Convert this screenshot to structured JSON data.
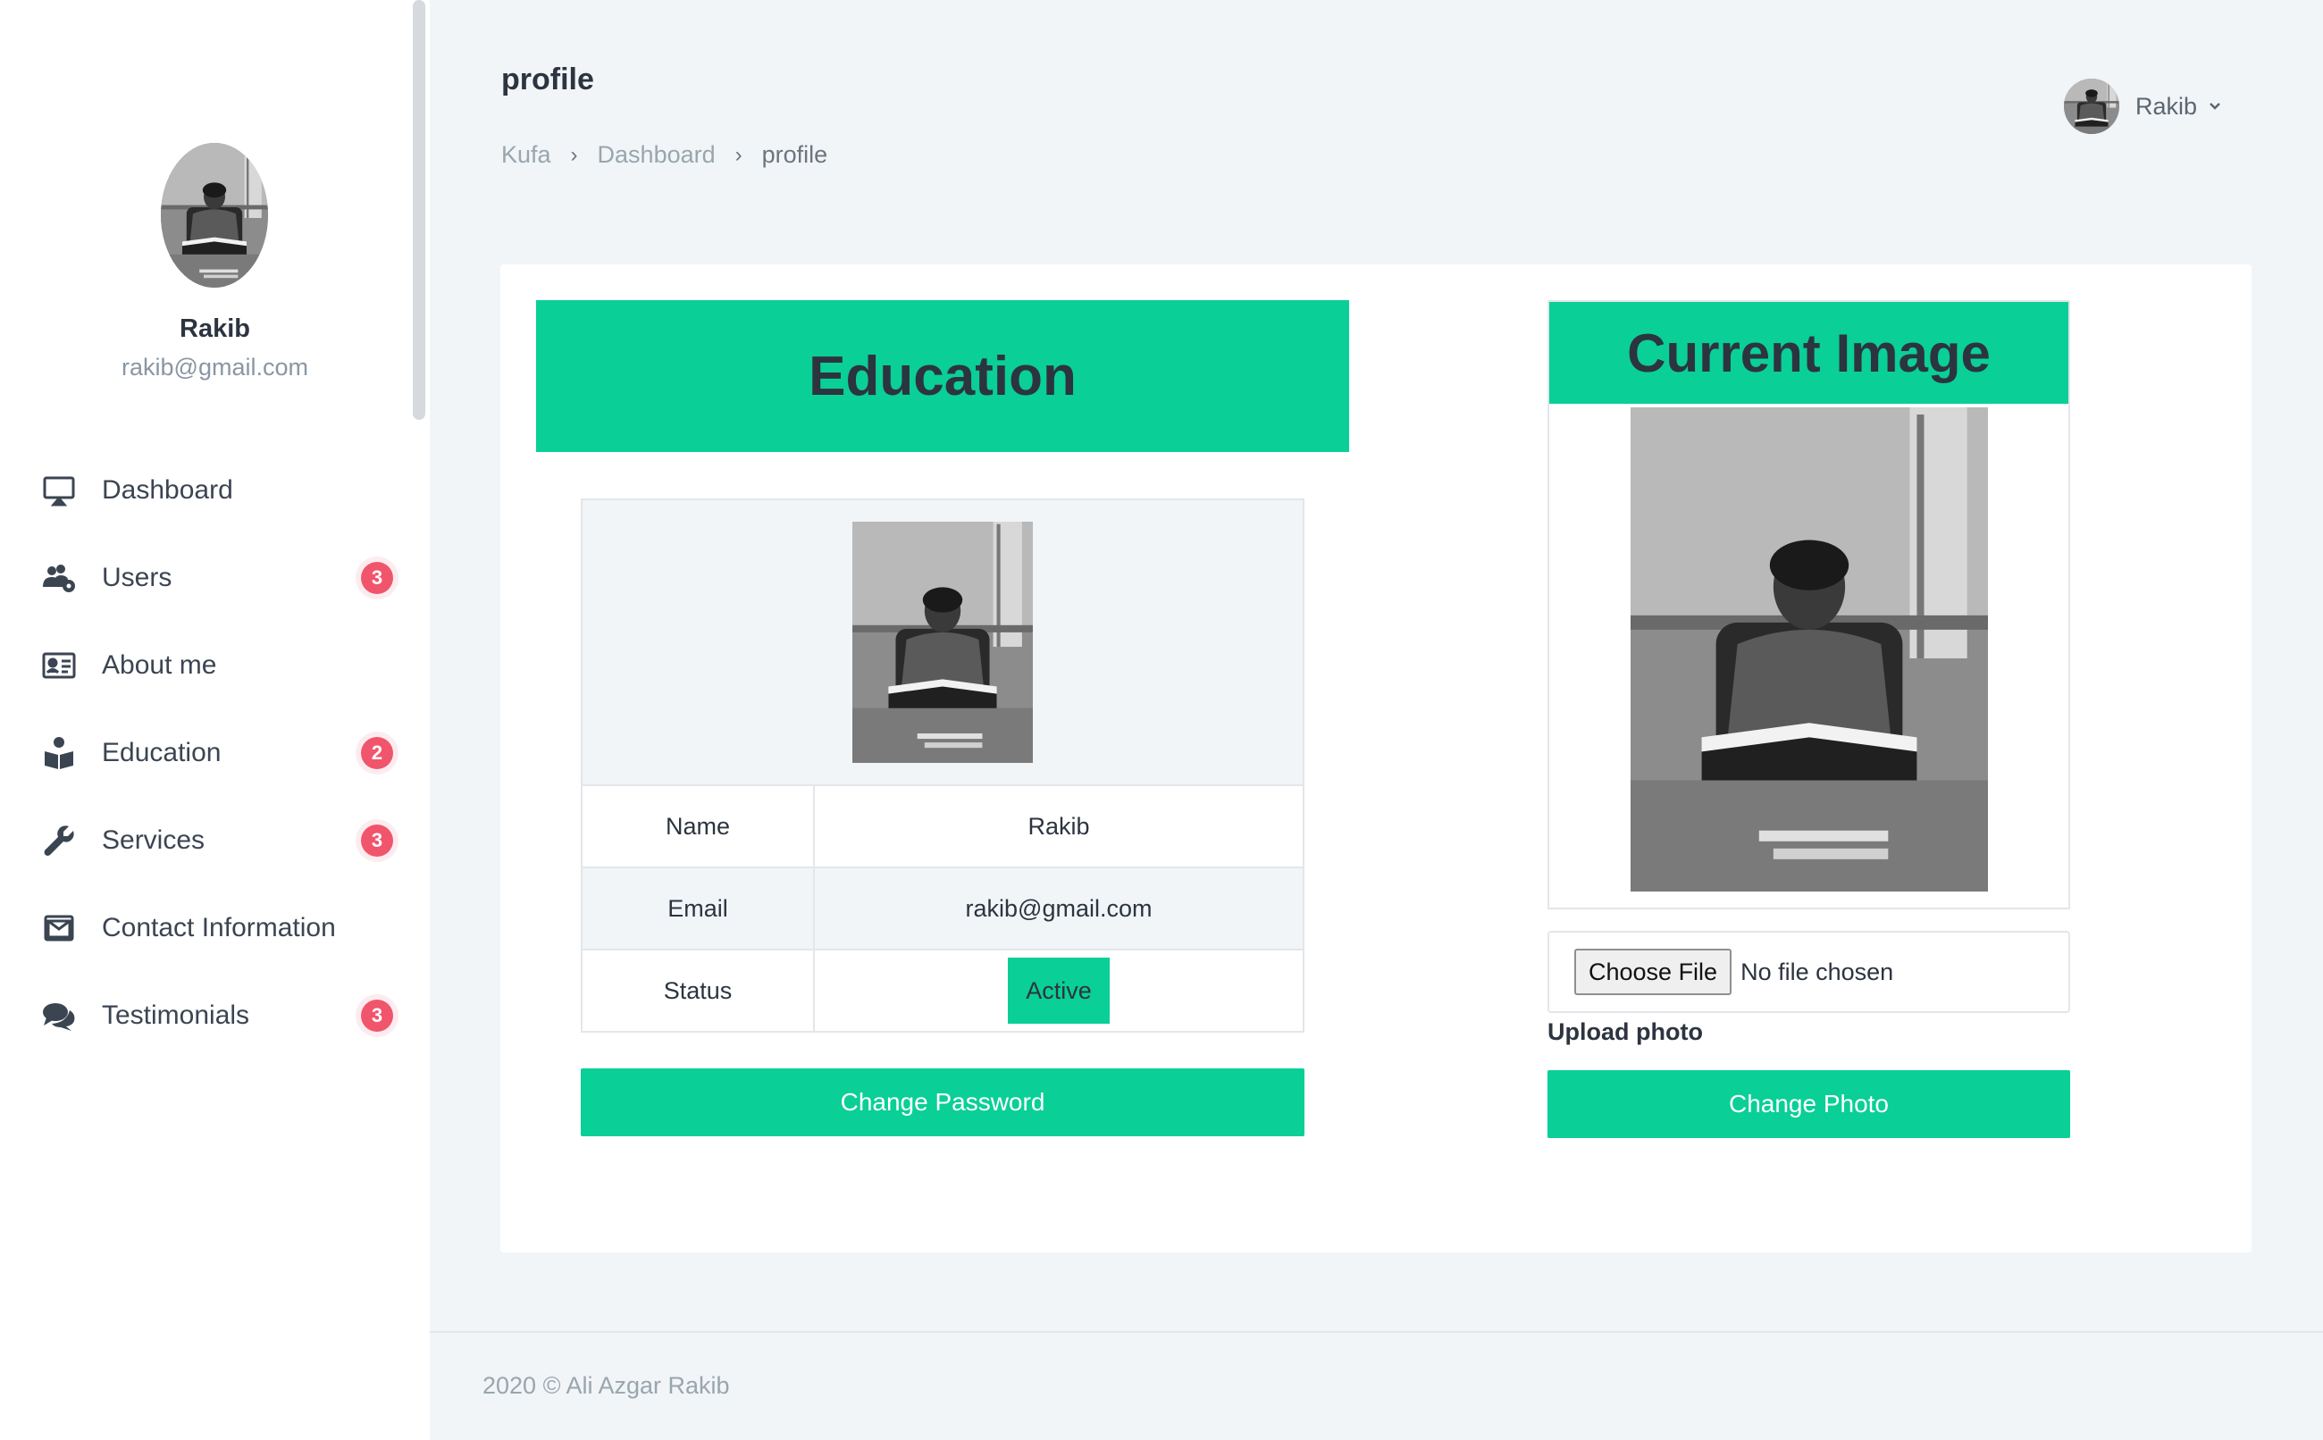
{
  "sidebar": {
    "user_name": "Rakib",
    "user_email": "rakib@gmail.com",
    "items": [
      {
        "label": "Dashboard",
        "icon": "monitor-icon",
        "badge": null
      },
      {
        "label": "Users",
        "icon": "users-cog-icon",
        "badge": "3"
      },
      {
        "label": "About me",
        "icon": "id-card-icon",
        "badge": null
      },
      {
        "label": "Education",
        "icon": "book-reader-icon",
        "badge": "2"
      },
      {
        "label": "Services",
        "icon": "wrench-icon",
        "badge": "3"
      },
      {
        "label": "Contact Information",
        "icon": "envelope-icon",
        "badge": null
      },
      {
        "label": "Testimonials",
        "icon": "comments-icon",
        "badge": "3"
      }
    ]
  },
  "header": {
    "title": "profile",
    "breadcrumb": [
      "Kufa",
      "Dashboard",
      "profile"
    ],
    "user_name": "Rakib"
  },
  "education": {
    "title": "Education",
    "rows": [
      {
        "label": "Name",
        "value": "Rakib"
      },
      {
        "label": "Email",
        "value": "rakib@gmail.com"
      },
      {
        "label": "Status",
        "value": "Active"
      }
    ],
    "change_password_label": "Change Password"
  },
  "current_image": {
    "title": "Current Image",
    "choose_file_label": "Choose File",
    "file_status": "No file chosen",
    "upload_label": "Upload photo",
    "change_photo_label": "Change Photo"
  },
  "footer": {
    "text": "2020 © Ali Azgar Rakib"
  },
  "colors": {
    "accent": "#0acf97",
    "badge": "#f1556c",
    "background": "#f2f5f8"
  }
}
